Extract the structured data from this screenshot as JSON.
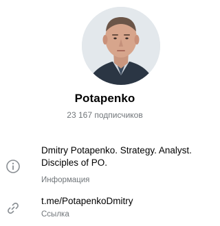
{
  "profile": {
    "name": "Potapenko",
    "subscribers": "23 167 подписчиков"
  },
  "about": {
    "icon": "info-icon",
    "text": "Dmitry Potapenko. Strategy. Analyst. Disciples of PO.",
    "caption": "Информация"
  },
  "link": {
    "icon": "link-icon",
    "url": "t.me/PotapenkoDmitry",
    "caption": "Ссылка"
  },
  "colors": {
    "secondary_text": "#707579",
    "icon_gray": "#8a8f94",
    "avatar_background": "#dfe5ea"
  }
}
